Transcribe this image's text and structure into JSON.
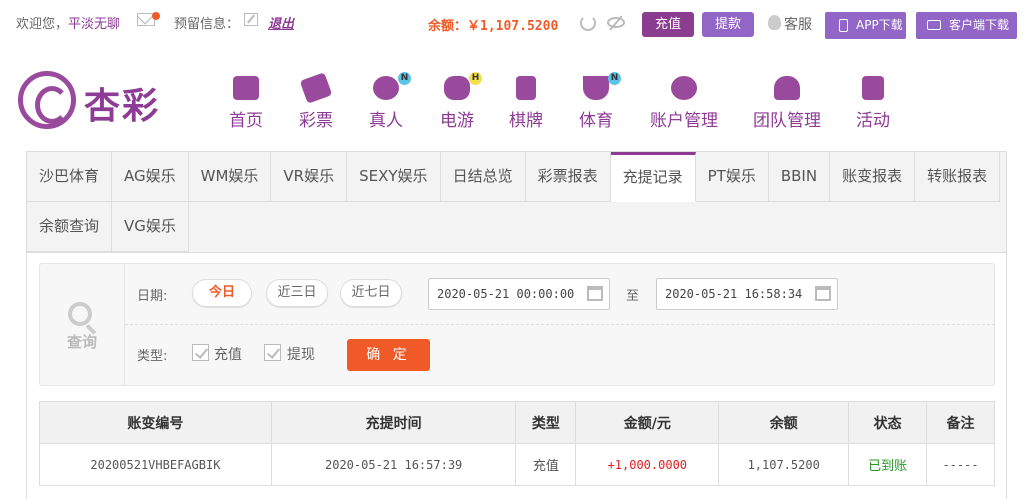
{
  "top": {
    "welcome": "欢迎您，",
    "username": "平淡无聊",
    "reserve_label": "预留信息：",
    "logout": "退出",
    "balance": "余额：￥1,107.5200",
    "recharge": "充值",
    "withdraw": "提款",
    "customer_service": "客服",
    "app_download": "APP下载",
    "client_download": "客户端下载"
  },
  "logo": {
    "text": "杏彩"
  },
  "nav": [
    {
      "label": "首页",
      "icon": "home-icon"
    },
    {
      "label": "彩票",
      "icon": "lottery-icon"
    },
    {
      "label": "真人",
      "icon": "live-dealer-icon",
      "badge": "N"
    },
    {
      "label": "电游",
      "icon": "gamepad-icon",
      "badge": "H"
    },
    {
      "label": "棋牌",
      "icon": "cards-icon"
    },
    {
      "label": "体育",
      "icon": "trophy-icon",
      "badge": "N"
    },
    {
      "label": "账户管理",
      "icon": "account-icon"
    },
    {
      "label": "团队管理",
      "icon": "team-icon"
    },
    {
      "label": "活动",
      "icon": "gift-icon"
    }
  ],
  "tabs_row1": [
    "沙巴体育",
    "AG娱乐",
    "WM娱乐",
    "VR娱乐",
    "SEXY娱乐",
    "日结总览",
    "彩票报表",
    "充提记录",
    "PT娱乐",
    "BBIN",
    "账变报表",
    "转账报表"
  ],
  "tabs_row2": [
    "余额查询",
    "VG娱乐"
  ],
  "active_tab": "充提记录",
  "search": {
    "title": "查询",
    "date_label": "日期:",
    "ranges": [
      "今日",
      "近三日",
      "近七日"
    ],
    "start": "2020-05-21 00:00:00",
    "to": "至",
    "end": "2020-05-21 16:58:34",
    "type_label": "类型:",
    "types": [
      "充值",
      "提现"
    ],
    "confirm": "确 定"
  },
  "table": {
    "headers": [
      "账变编号",
      "充提时间",
      "类型",
      "金额/元",
      "余额",
      "状态",
      "备注"
    ],
    "rows": [
      [
        "20200521VHBEFAGBIK",
        "2020-05-21 16:57:39",
        "充值",
        "+1,000.0000",
        "1,107.5200",
        "已到账",
        "-----"
      ]
    ]
  },
  "colors": {
    "brand": "#8d3b95",
    "accent": "#f05a28",
    "success": "#2a9a2a"
  }
}
